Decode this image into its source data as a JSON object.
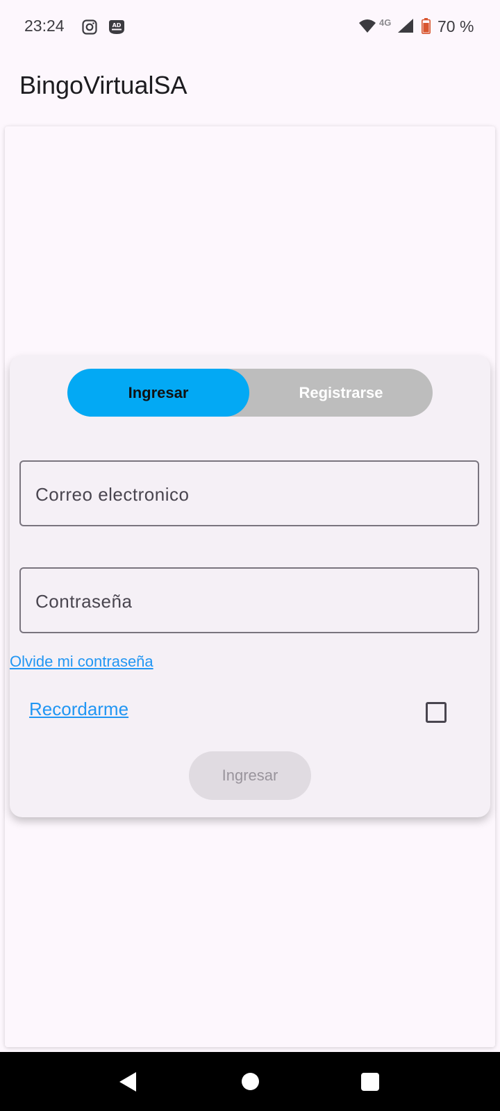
{
  "status_bar": {
    "time": "23:24",
    "network": "4G",
    "battery": "70 %",
    "icons": [
      "instagram-icon",
      "adblock-icon",
      "wifi-icon",
      "signal-icon",
      "battery-icon"
    ]
  },
  "app_bar": {
    "title": "BingoVirtualSA"
  },
  "login": {
    "tabs": [
      {
        "label": "Ingresar",
        "active": true
      },
      {
        "label": "Registrarse",
        "active": false
      }
    ],
    "email_placeholder": "Correo electronico",
    "password_placeholder": "Contraseña",
    "forgot_password": "Olvide mi contraseña",
    "remember_me": "Recordarme",
    "remember_checked": false,
    "submit_label": "Ingresar"
  },
  "colors": {
    "accent": "#03a9f4",
    "link": "#2196f3",
    "inactive_tab": "#bdbdbd",
    "background": "#fdf7fd"
  }
}
